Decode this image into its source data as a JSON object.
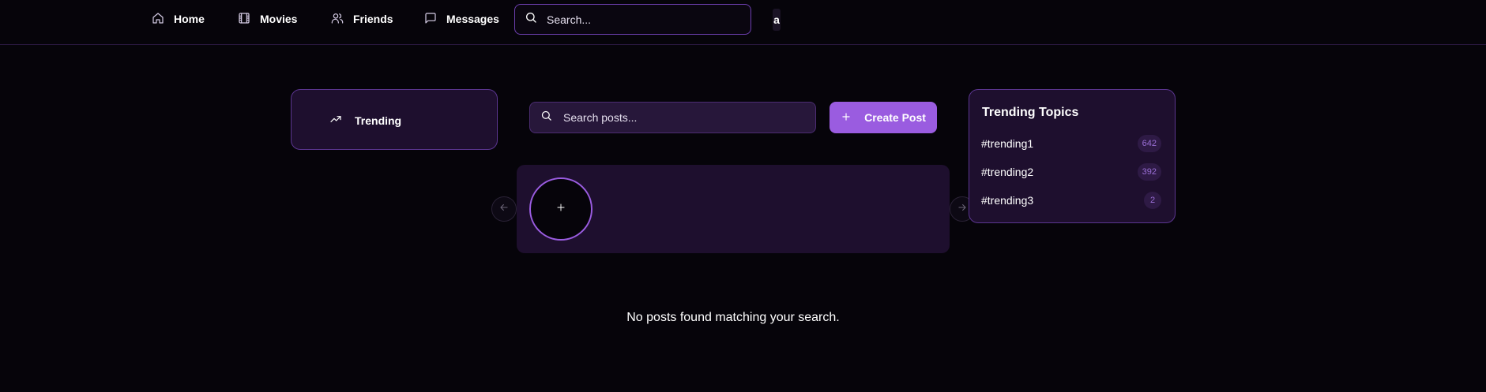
{
  "nav": {
    "items": [
      {
        "label": "Home",
        "icon": "home-icon"
      },
      {
        "label": "Movies",
        "icon": "film-icon"
      },
      {
        "label": "Friends",
        "icon": "users-icon"
      },
      {
        "label": "Messages",
        "icon": "message-square-icon"
      }
    ],
    "search_placeholder": "Search...",
    "avatar_initial": "a"
  },
  "sidebar": {
    "items": [
      {
        "label": "Trending",
        "icon": "trending-up-icon"
      }
    ]
  },
  "feed": {
    "search_placeholder": "Search posts...",
    "create_post_label": "Create Post",
    "empty_message": "No posts found matching your search."
  },
  "stories": {
    "add_icon": "plus-icon",
    "prev_icon": "arrow-left-icon",
    "next_icon": "arrow-right-icon"
  },
  "trending": {
    "title": "Trending Topics",
    "topics": [
      {
        "tag": "#trending1",
        "count": "642"
      },
      {
        "tag": "#trending2",
        "count": "392"
      },
      {
        "tag": "#trending3",
        "count": "2"
      }
    ]
  },
  "colors": {
    "background": "#06040a",
    "card": "#1e0f2e",
    "card_border": "#5b3590",
    "accent": "#9a5ce0",
    "badge_text": "#9a6fd6"
  }
}
